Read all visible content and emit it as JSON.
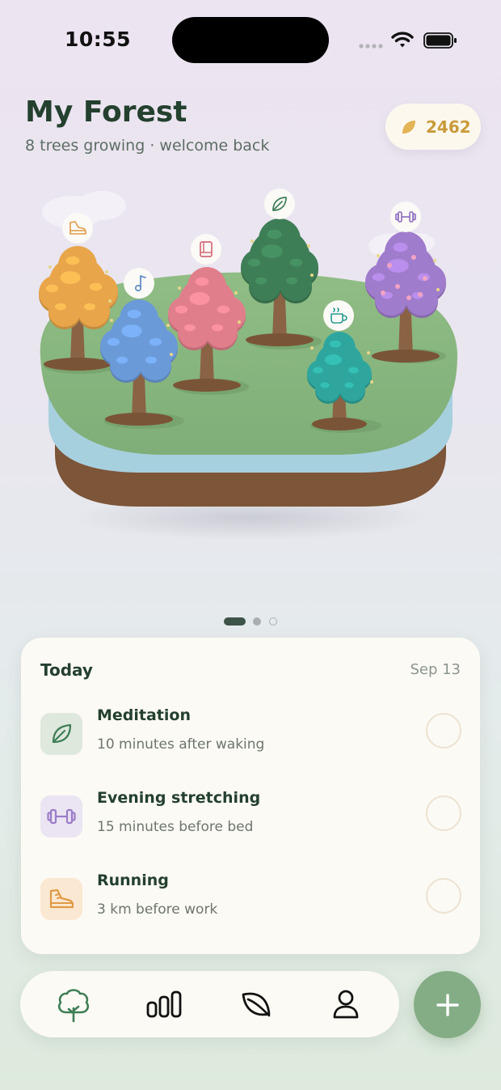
{
  "status_bar": {
    "time": "10:55"
  },
  "header": {
    "title": "My Forest",
    "subtitle": "8 trees growing · welcome back",
    "points": "2462"
  },
  "forest": {
    "trees": [
      {
        "name": "Running",
        "color": "#e8a54a",
        "icon": "running-shoe-icon"
      },
      {
        "name": "Music",
        "color": "#6b9ad8",
        "icon": "music-note-icon"
      },
      {
        "name": "Reading",
        "color": "#e17e8b",
        "icon": "book-icon"
      },
      {
        "name": "Meditation",
        "color": "#3e7e56",
        "icon": "leaf-icon"
      },
      {
        "name": "Coffee",
        "color": "#2ea69e",
        "icon": "coffee-cup-icon"
      },
      {
        "name": "Workout",
        "color": "#a07ccc",
        "icon": "dumbbell-icon"
      }
    ],
    "pager": {
      "pages": 3,
      "current": 1
    }
  },
  "today": {
    "title": "Today",
    "date": "Sep 13",
    "habits": [
      {
        "name": "Meditation",
        "description": "10 minutes after waking",
        "icon": "leaf-icon",
        "icon_bg": "#dee8dc",
        "icon_color": "#3e7e56",
        "done": false
      },
      {
        "name": "Evening stretching",
        "description": "15 minutes before bed",
        "icon": "dumbbell-icon",
        "icon_bg": "#ebe4f2",
        "icon_color": "#9a7cc6",
        "done": false
      },
      {
        "name": "Running",
        "description": "3 km before work",
        "icon": "running-shoe-icon",
        "icon_bg": "#fbe8d2",
        "icon_color": "#e09a45",
        "done": false
      }
    ]
  },
  "tab_bar": {
    "tabs": [
      {
        "icon": "tree-icon",
        "active": true
      },
      {
        "icon": "bar-chart-icon",
        "active": false
      },
      {
        "icon": "leaf-icon",
        "active": false
      },
      {
        "icon": "profile-icon",
        "active": false
      }
    ],
    "add_icon": "plus-icon"
  },
  "colors": {
    "accent": "#84ad86",
    "title": "#24402e",
    "points": "#c99b3a",
    "card": "#fcfaf4"
  }
}
